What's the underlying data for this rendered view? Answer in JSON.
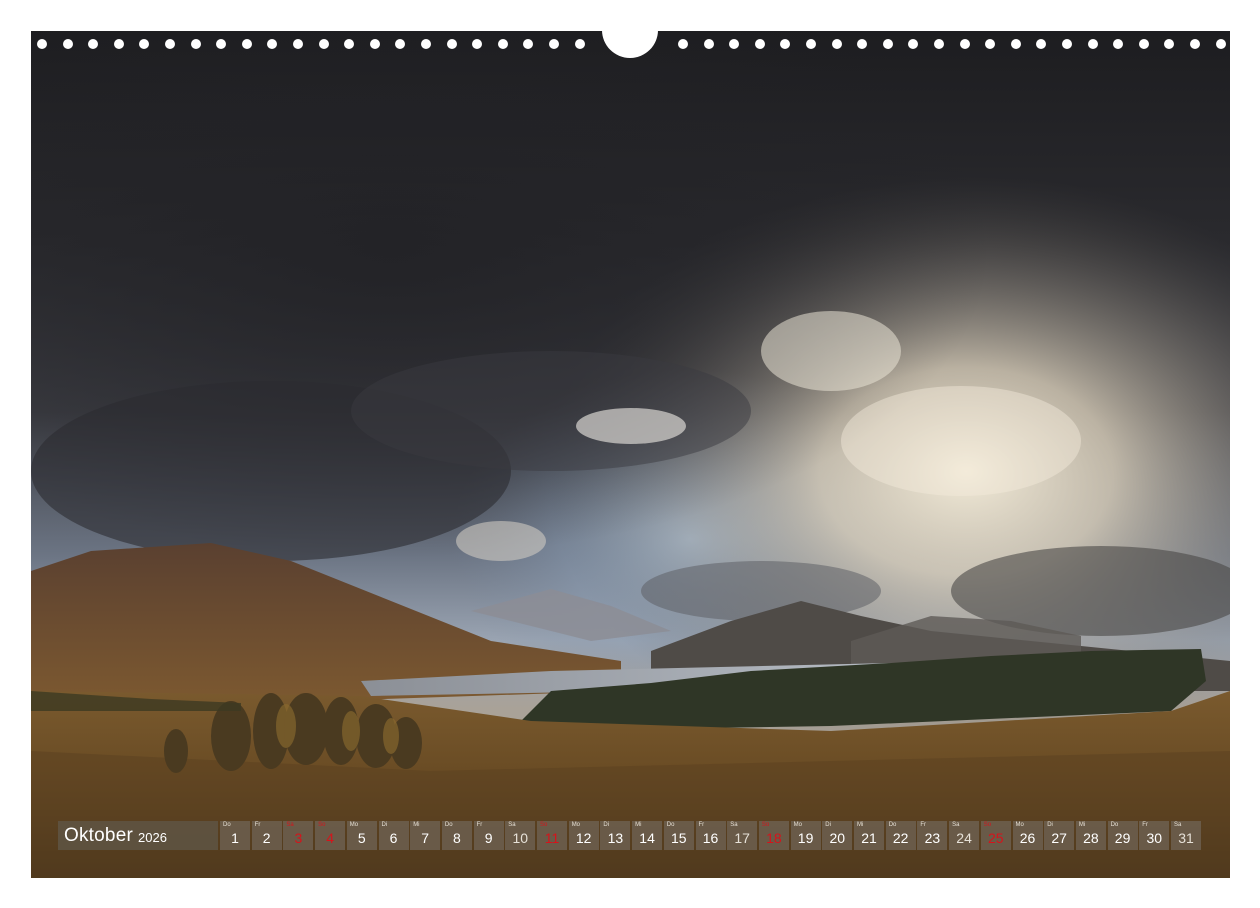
{
  "calendar": {
    "month": "Oktober",
    "year": "2026",
    "days": [
      {
        "num": "1",
        "abbr": "Do",
        "type": "weekday"
      },
      {
        "num": "2",
        "abbr": "Fr",
        "type": "weekday"
      },
      {
        "num": "3",
        "abbr": "Sa",
        "type": "sunday"
      },
      {
        "num": "4",
        "abbr": "So",
        "type": "sunday"
      },
      {
        "num": "5",
        "abbr": "Mo",
        "type": "weekday"
      },
      {
        "num": "6",
        "abbr": "Di",
        "type": "weekday"
      },
      {
        "num": "7",
        "abbr": "Mi",
        "type": "weekday"
      },
      {
        "num": "8",
        "abbr": "Do",
        "type": "weekday"
      },
      {
        "num": "9",
        "abbr": "Fr",
        "type": "weekday"
      },
      {
        "num": "10",
        "abbr": "Sa",
        "type": "saturday"
      },
      {
        "num": "11",
        "abbr": "So",
        "type": "sunday"
      },
      {
        "num": "12",
        "abbr": "Mo",
        "type": "weekday"
      },
      {
        "num": "13",
        "abbr": "Di",
        "type": "weekday"
      },
      {
        "num": "14",
        "abbr": "Mi",
        "type": "weekday"
      },
      {
        "num": "15",
        "abbr": "Do",
        "type": "weekday"
      },
      {
        "num": "16",
        "abbr": "Fr",
        "type": "weekday"
      },
      {
        "num": "17",
        "abbr": "Sa",
        "type": "saturday"
      },
      {
        "num": "18",
        "abbr": "So",
        "type": "sunday"
      },
      {
        "num": "19",
        "abbr": "Mo",
        "type": "weekday"
      },
      {
        "num": "20",
        "abbr": "Di",
        "type": "weekday"
      },
      {
        "num": "21",
        "abbr": "Mi",
        "type": "weekday"
      },
      {
        "num": "22",
        "abbr": "Do",
        "type": "weekday"
      },
      {
        "num": "23",
        "abbr": "Fr",
        "type": "weekday"
      },
      {
        "num": "24",
        "abbr": "Sa",
        "type": "saturday"
      },
      {
        "num": "25",
        "abbr": "So",
        "type": "sunday"
      },
      {
        "num": "26",
        "abbr": "Mo",
        "type": "weekday"
      },
      {
        "num": "27",
        "abbr": "Di",
        "type": "weekday"
      },
      {
        "num": "28",
        "abbr": "Mi",
        "type": "weekday"
      },
      {
        "num": "29",
        "abbr": "Do",
        "type": "weekday"
      },
      {
        "num": "30",
        "abbr": "Fr",
        "type": "weekday"
      },
      {
        "num": "31",
        "abbr": "Sa",
        "type": "saturday"
      }
    ]
  },
  "colors": {
    "holiday_red": "#d6131b",
    "strip_bg": "#6e6252",
    "page_bg": "#ffffff"
  },
  "photo": {
    "subject": "landscape-photo"
  }
}
